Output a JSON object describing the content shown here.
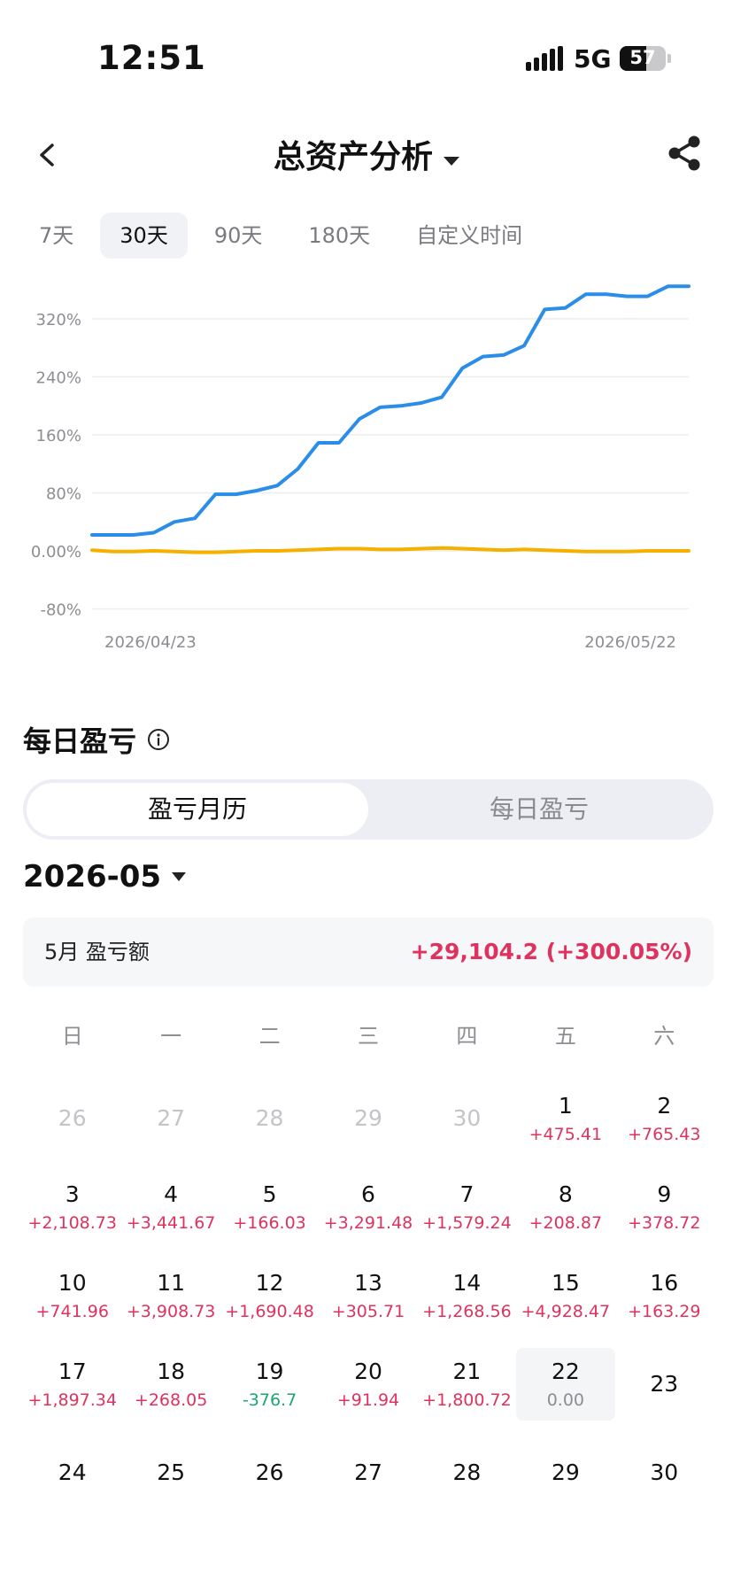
{
  "status": {
    "time": "12:51",
    "network": "5G",
    "battery": "57",
    "battery_level": 0.57
  },
  "header": {
    "title": "总资产分析"
  },
  "periods": [
    "7天",
    "30天",
    "90天",
    "180天",
    "自定义时间"
  ],
  "active_period": 1,
  "chart_data": {
    "type": "line",
    "y_tick_labels": [
      "320%",
      "240%",
      "160%",
      "80%",
      "0.00%",
      "-80%"
    ],
    "y_ticks": [
      320,
      240,
      160,
      80,
      0,
      -80
    ],
    "ylim": [
      -80,
      360
    ],
    "x_tick_labels": [
      "2026/04/23",
      "2026/05/22"
    ],
    "series": [
      {
        "color": "#2a8de8",
        "values": [
          22,
          22,
          22,
          25,
          40,
          45,
          78,
          78,
          83,
          90,
          113,
          149,
          149,
          182,
          198,
          200,
          204,
          212,
          252,
          268,
          270,
          283,
          333,
          335,
          354,
          354,
          351,
          351,
          365,
          365
        ]
      },
      {
        "color": "#f5b000",
        "values": [
          1,
          -1,
          -1,
          0,
          -1,
          -2,
          -2,
          -1,
          0,
          0,
          1,
          2,
          3,
          3,
          2,
          2,
          3,
          4,
          3,
          2,
          1,
          2,
          1,
          0,
          -1,
          -1,
          -1,
          0,
          0,
          0
        ]
      }
    ]
  },
  "section": {
    "title": "每日盈亏"
  },
  "segment": {
    "left": "盈亏月历",
    "right": "每日盈亏"
  },
  "month": "2026-05",
  "summary": {
    "label": "5月 盈亏额",
    "value": "+29,104.2 (+300.05%)"
  },
  "weekdays": [
    "日",
    "一",
    "二",
    "三",
    "四",
    "五",
    "六"
  ],
  "days": [
    {
      "num": "26",
      "pnl": "",
      "muted": true
    },
    {
      "num": "27",
      "pnl": "",
      "muted": true
    },
    {
      "num": "28",
      "pnl": "",
      "muted": true
    },
    {
      "num": "29",
      "pnl": "",
      "muted": true
    },
    {
      "num": "30",
      "pnl": "",
      "muted": true
    },
    {
      "num": "1",
      "pnl": "+475.41"
    },
    {
      "num": "2",
      "pnl": "+765.43"
    },
    {
      "num": "3",
      "pnl": "+2,108.73"
    },
    {
      "num": "4",
      "pnl": "+3,441.67"
    },
    {
      "num": "5",
      "pnl": "+166.03"
    },
    {
      "num": "6",
      "pnl": "+3,291.48"
    },
    {
      "num": "7",
      "pnl": "+1,579.24"
    },
    {
      "num": "8",
      "pnl": "+208.87"
    },
    {
      "num": "9",
      "pnl": "+378.72"
    },
    {
      "num": "10",
      "pnl": "+741.96"
    },
    {
      "num": "11",
      "pnl": "+3,908.73"
    },
    {
      "num": "12",
      "pnl": "+1,690.48"
    },
    {
      "num": "13",
      "pnl": "+305.71"
    },
    {
      "num": "14",
      "pnl": "+1,268.56"
    },
    {
      "num": "15",
      "pnl": "+4,928.47"
    },
    {
      "num": "16",
      "pnl": "+163.29"
    },
    {
      "num": "17",
      "pnl": "+1,897.34"
    },
    {
      "num": "18",
      "pnl": "+268.05"
    },
    {
      "num": "19",
      "pnl": "-376.7",
      "neg": true
    },
    {
      "num": "20",
      "pnl": "+91.94"
    },
    {
      "num": "21",
      "pnl": "+1,800.72"
    },
    {
      "num": "22",
      "pnl": "0.00",
      "zero": true,
      "today": true
    },
    {
      "num": "23",
      "pnl": ""
    },
    {
      "num": "24",
      "pnl": ""
    },
    {
      "num": "25",
      "pnl": ""
    },
    {
      "num": "26",
      "pnl": ""
    },
    {
      "num": "27",
      "pnl": ""
    },
    {
      "num": "28",
      "pnl": ""
    },
    {
      "num": "29",
      "pnl": ""
    },
    {
      "num": "30",
      "pnl": ""
    }
  ]
}
